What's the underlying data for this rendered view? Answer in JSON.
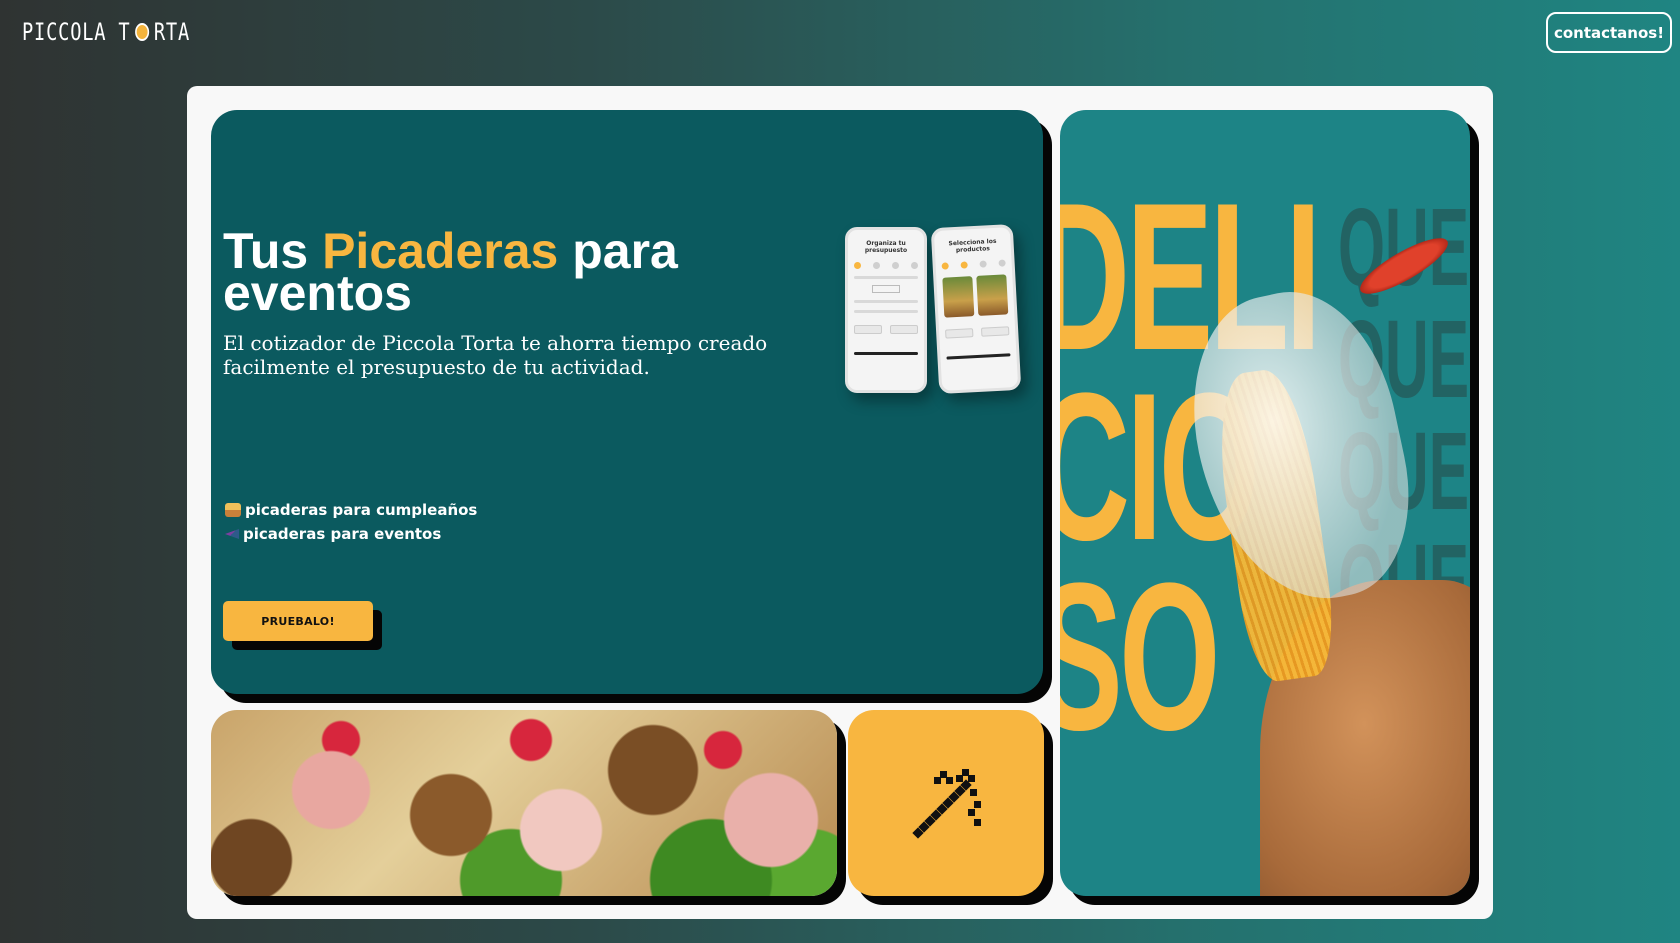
{
  "header": {
    "logo_text": "Piccola Torta",
    "contact_button_label": "contactanos!"
  },
  "hero": {
    "title_before": "Tus ",
    "title_accent": "Picaderas",
    "title_after": " para eventos",
    "subtitle": "El cotizador de Piccola Torta te ahorra tiempo creado facilmente el presupuesto de tu actividad.",
    "list_items": [
      {
        "icon": "birthday-cake-icon",
        "label": "picaderas para cumpleaños"
      },
      {
        "icon": "dancing-shoe-icon",
        "label": "picaderas para eventos"
      }
    ],
    "cta_label": "PRUEBALO!",
    "phone1_title": "Organiza tu presupuesto",
    "phone2_title": "Selecciona los productos"
  },
  "promo": {
    "big_text": "DELI\nCIO\nSO",
    "ghost_text": "QUES\nQUES\nQUES\nQUES"
  },
  "icon_card": {
    "icon": "magic-wand-icon"
  },
  "colors": {
    "accent": "#f8b640",
    "hero_bg": "#0b5a5f",
    "promo_bg": "#1d8486",
    "container_bg": "#f8f8f8"
  }
}
